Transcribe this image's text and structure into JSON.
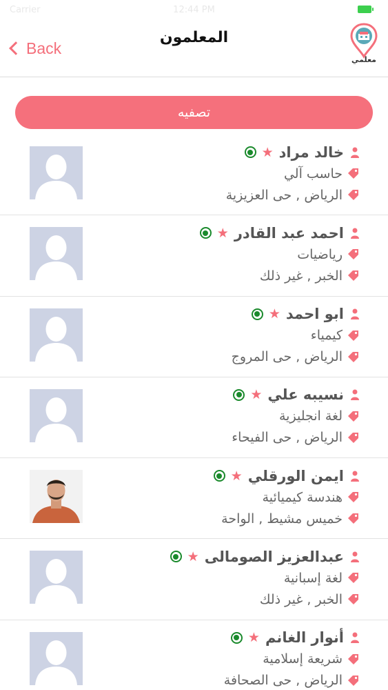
{
  "status_bar": {
    "carrier": "Carrier",
    "time": "12:44 PM"
  },
  "nav": {
    "back_label": "Back",
    "title": "المعلمون",
    "logo_label": "معلمي"
  },
  "filter_button": "تصفيه",
  "colors": {
    "accent": "#f46f7b",
    "online": "#1a8a2c",
    "avatar_bg": "#cdd3e4"
  },
  "teachers": [
    {
      "name": "خالد مراد",
      "subject": "حاسب آلي",
      "location": "الرياض , حى العزيزية",
      "photo": "placeholder"
    },
    {
      "name": "احمد عبد القادر",
      "subject": "رياضيات",
      "location": "الخبر , غير ذلك",
      "photo": "placeholder"
    },
    {
      "name": "ابو احمد",
      "subject": "كيمياء",
      "location": "الرياض , حى المروج",
      "photo": "placeholder"
    },
    {
      "name": "نسيبه علي",
      "subject": "لغة انجليزية",
      "location": "الرياض , حى الفيحاء",
      "photo": "placeholder"
    },
    {
      "name": "ايمن الورقلي",
      "subject": "هندسة كيميائية",
      "location": "خميس مشيط , الواحة",
      "photo": "real"
    },
    {
      "name": "عبدالعزيز الصومالى",
      "subject": "لغة إسبانية",
      "location": "الخبر , غير ذلك",
      "photo": "placeholder"
    },
    {
      "name": "أنوار الغانم",
      "subject": "شريعة إسلامية",
      "location": "الرياض , حى الصحافة",
      "photo": "placeholder"
    }
  ]
}
